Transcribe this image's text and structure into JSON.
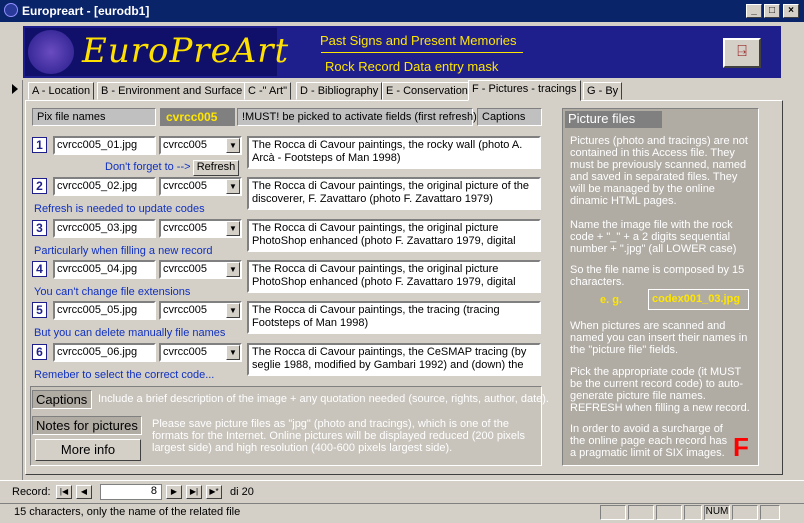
{
  "window": {
    "title": "Europreart - [eurodb1]",
    "min": "_",
    "max": "□",
    "close": "×"
  },
  "header": {
    "logo_text": "EuroPreArt",
    "line1": "Past Signs and Present Memories",
    "line2": "Rock Record Data entry mask"
  },
  "tabs": [
    "A - Location",
    "B - Environment and Surface",
    "C -\" Art\"",
    "D - Bibliography",
    "E - Conservation",
    "F - Pictures - tracings",
    "G - By"
  ],
  "form": {
    "pix_label": "Pix file names",
    "code": "cvrcc005",
    "must_note": "!MUST! be picked to activate fields (first refresh)",
    "captions_label": "Captions",
    "refresh_button": "Refresh",
    "rows": [
      {
        "n": "1",
        "file": "cvrcc005_01.jpg",
        "code": "cvrcc005",
        "caption": "The Rocca di Cavour paintings, the rocky wall (photo A. Arcà - Footsteps of Man 1998)",
        "hint": "Don't forget to -->"
      },
      {
        "n": "2",
        "file": "cvrcc005_02.jpg",
        "code": "cvrcc005",
        "caption": "The Rocca di Cavour paintings, the original picture of the discoverer, F. Zavattaro (photo F. Zavattaro 1979)",
        "hint": "Refresh is needed to update codes"
      },
      {
        "n": "3",
        "file": "cvrcc005_03.jpg",
        "code": "cvrcc005",
        "caption": "The Rocca di Cavour paintings, the original picture PhotoShop enhanced (photo F. Zavattaro 1979, digital",
        "hint": "Particularly when filling a new record"
      },
      {
        "n": "4",
        "file": "cvrcc005_04.jpg",
        "code": "cvrcc005",
        "caption": "The Rocca di Cavour paintings, the original picture PhotoShop enhanced (photo F. Zavattaro 1979, digital",
        "hint": "You can't change file extensions"
      },
      {
        "n": "5",
        "file": "cvrcc005_05.jpg",
        "code": "cvrcc005",
        "caption": "The Rocca di Cavour paintings, the tracing (tracing Footsteps of Man 1998)",
        "hint": "But you can delete manually file names"
      },
      {
        "n": "6",
        "file": "cvrcc005_06.jpg",
        "code": "cvrcc005",
        "caption": "The Rocca di Cavour paintings, the CeSMAP tracing (by seglie 1988, modified by Gambari 1992) and (down) the",
        "hint": "Remeber to select the correct code..."
      }
    ],
    "captions_title": "Captions",
    "captions_text": "Include a brief description of the image + any quotation needed (source, rights, author, date).",
    "notes_title": "Notes for pictures",
    "notes_text": "Please save picture files as \"jpg\" (photo and tracings), which is one of the formats for the Internet. Online pictures will be displayed reduced (200 pixels largest side) and high resolution (400-600 pixels largest side).",
    "more_info": "More info"
  },
  "right_panel": {
    "title": "Picture files",
    "p1": "Pictures (photo and tracings) are not contained in this Access file.  They must be previously scanned, named and saved in separated files.  They will be managed by the online dinamic HTML pages.",
    "p2": "Name the image file with the rock code + \"_\" + a 2 digits sequential number + \".jpg\" (all LOWER case)",
    "p3": "So the file name is composed by 15 characters.",
    "eg": "e. g.",
    "example": "codex001_03.jpg",
    "p4": "When pictures are scanned and named  you can insert their names in the \"picture file\" fields.",
    "p5": "Pick the appropriate code (it  MUST be the current record code) to auto-generate picture file names. REFRESH when filling a new record.",
    "p6": "In order to avoid a surcharge of the online page each record has a pragmatic limit of SIX images.",
    "letter": "F"
  },
  "nav": {
    "label": "Record:",
    "current": "8",
    "total": "di 20"
  },
  "status": {
    "text": "15  characters, only the name of the related file",
    "num": "NUM"
  }
}
